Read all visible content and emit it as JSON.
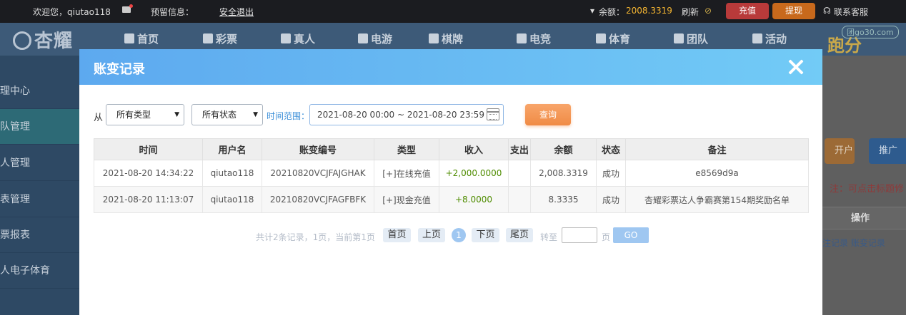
{
  "topbar": {
    "welcome": "欢迎您，qiutao118",
    "reserved_info": "预留信息：",
    "logout": "安全退出",
    "balance_label": "余额：",
    "balance_value": "2008.3319",
    "refresh": "刷新",
    "recharge": "充值",
    "withdraw": "提现",
    "support": "联系客服"
  },
  "nav": {
    "logo": "杏耀",
    "items": [
      "首页",
      "彩票",
      "真人",
      "电游",
      "棋牌",
      "电竞",
      "体育",
      "团队",
      "活动"
    ],
    "watermark": "团go30.com",
    "end_text": "跑分"
  },
  "sidebar": {
    "items": [
      "理中心",
      "队管理",
      "人管理",
      "表管理",
      "票报表",
      "人电子体育"
    ]
  },
  "background": {
    "btn1": "开户",
    "btn2": "推广",
    "note": "注：可点击标题修",
    "ops_header": "操作",
    "ops_links": "注记录  账变记录"
  },
  "modal": {
    "title": "账变记录",
    "filters": {
      "from_label": "从",
      "type_select": "所有类型",
      "status_select": "所有状态",
      "range_label": "时间范围：",
      "date_range": "2021-08-20 00:00 ~ 2021-08-20 23:59",
      "query_button": "查询"
    },
    "table": {
      "headers": [
        "时间",
        "用户名",
        "账变编号",
        "类型",
        "收入",
        "支出",
        "余额",
        "状态",
        "备注"
      ],
      "rows": [
        [
          "2021-08-20 14:34:22",
          "qiutao118",
          "20210820VCJFAJGHAK",
          "[+]在线充值",
          "+2,000.0000",
          "",
          "2,008.3319",
          "成功",
          "e8569d9a"
        ],
        [
          "2021-08-20 11:13:07",
          "qiutao118",
          "20210820VCJFAGFBFK",
          "[+]现金充值",
          "+8.0000",
          "",
          "8.3335",
          "成功",
          "杏耀彩票达人争霸赛第154期奖励名单"
        ]
      ]
    },
    "pagination": {
      "summary": "共计2条记录，1页，当前第1页",
      "first": "首页",
      "prev": "上页",
      "current": "1",
      "next": "下页",
      "last": "尾页",
      "goto_label": "转至",
      "page_unit": "页",
      "go": "GO"
    }
  },
  "colors": {
    "header_gradient_start": "#5da9ef",
    "header_gradient_end": "#72cbf6",
    "income_green": "#4f8c00",
    "query_orange": "#f08b45",
    "balance_gold": "#f3b431"
  }
}
